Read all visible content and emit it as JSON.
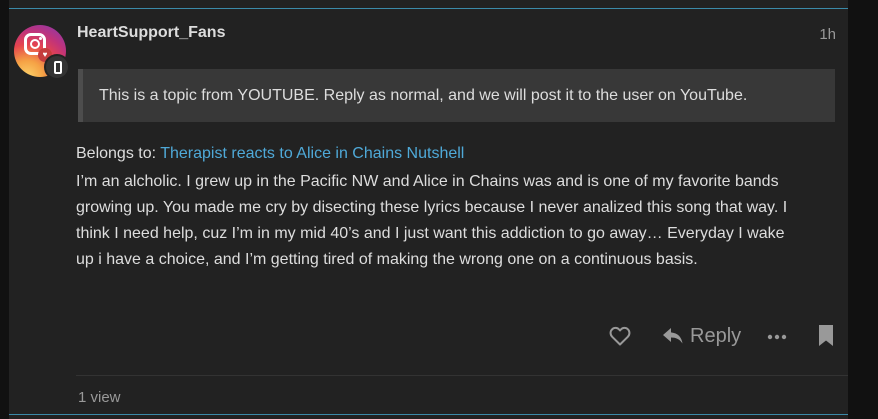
{
  "post": {
    "username": "HeartSupport_Fans",
    "timestamp": "1h",
    "notice": "This is a topic from YOUTUBE. Reply as normal, and we will post it to the user on YouTube.",
    "belongs_label": "Belongs to: ",
    "belongs_link": "Therapist reacts to Alice in Chains Nutshell",
    "body_lines": [
      "I’m an alcholic. I grew up in the Pacific NW and Alice in Chains was and is one of my favorite bands",
      "growing up. You made me cry by disecting these lyrics because I never analized this song that way. I",
      "think I need help, cuz I’m in my mid 40’s and I just want this addiction to go away… Everyday I wake",
      "up i have a choice, and I’m getting tired of making the wrong one on a continuous basis."
    ]
  },
  "actions": {
    "reply_label": "Reply",
    "like_icon": "heart-outline-icon",
    "reply_icon": "reply-arrow-icon",
    "more_icon": "ellipsis-icon",
    "bookmark_icon": "bookmark-icon"
  },
  "footer": {
    "views": "1 view"
  },
  "colors": {
    "background": "#222222",
    "accent_border": "#3b8aa8",
    "link": "#4fa9d8",
    "muted": "#999999",
    "text": "#dddddd"
  }
}
